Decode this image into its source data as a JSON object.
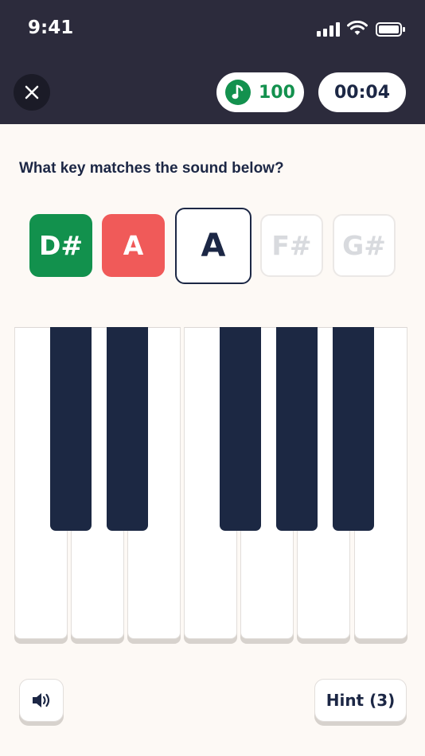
{
  "status_bar": {
    "time": "9:41",
    "icons": [
      "signal-icon",
      "wifi-icon",
      "battery-icon"
    ]
  },
  "header": {
    "close_icon": "close-icon",
    "score": "100",
    "score_icon": "music-note-icon",
    "timer": "00:04"
  },
  "question": "What key matches the sound below?",
  "answer_slots": [
    {
      "label": "D#",
      "state": "correct"
    },
    {
      "label": "A",
      "state": "wrong"
    },
    {
      "label": "A",
      "state": "current"
    },
    {
      "label": "F#",
      "state": "upcoming"
    },
    {
      "label": "G#",
      "state": "upcoming"
    }
  ],
  "piano": {
    "white_keys": 7,
    "black_keys": 5
  },
  "footer": {
    "sound_icon": "speaker-icon",
    "hint_label": "Hint (3)"
  },
  "colors": {
    "header_bg": "#2c2b3c",
    "correct": "#12914d",
    "wrong": "#f05a59",
    "text_dark": "#1c2745",
    "black_key": "#1c2843"
  }
}
